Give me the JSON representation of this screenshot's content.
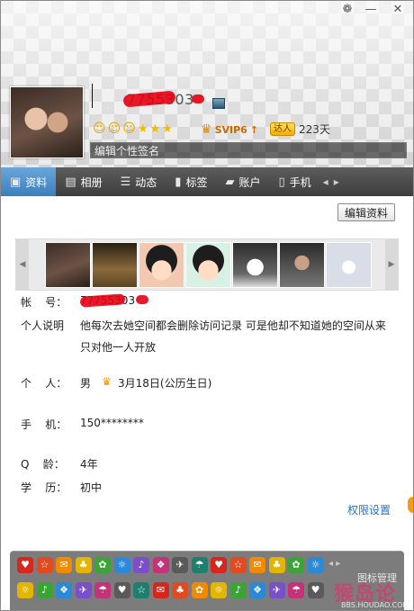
{
  "window_controls": {
    "skin_icon": "skin-icon",
    "minimize": "—",
    "close": "✕"
  },
  "profile": {
    "qq_number_visible": "7755303",
    "level_icons": [
      "sun",
      "sun",
      "sun",
      "star",
      "star",
      "star"
    ],
    "svip_label": "SVIP6",
    "daren_label": "达人",
    "days": "223天",
    "signature_placeholder": "编辑个性签名"
  },
  "tabs": [
    {
      "label": "资料",
      "icon": "id-card-icon"
    },
    {
      "label": "相册",
      "icon": "album-icon"
    },
    {
      "label": "动态",
      "icon": "feed-icon"
    },
    {
      "label": "标签",
      "icon": "bookmark-icon"
    },
    {
      "label": "账户",
      "icon": "wallet-icon"
    },
    {
      "label": "手机",
      "icon": "phone-icon"
    }
  ],
  "edit_profile_button": "编辑资料",
  "info": {
    "account_label": "帐    号：",
    "account_value": "77755303",
    "desc_label": "个人说明",
    "desc_line1": "他每次去她空间都会删除访问记录 可是他却不知道她的空间从来",
    "desc_line2": "只对他一人开放",
    "personal_label": "个    人：",
    "gender": "男",
    "birthday": "3月18日(公历生日)",
    "phone_label": "手    机：",
    "phone_value": "150********",
    "age_label": "Q    龄：",
    "age_value": "4年",
    "edu_label": "学    历：",
    "edu_value": "初中"
  },
  "permission_link": "权限设置",
  "icon_manage": "图标管理",
  "watermark": "猴岛论坛",
  "watermark_url": "BBS.HOUDAO.COM"
}
